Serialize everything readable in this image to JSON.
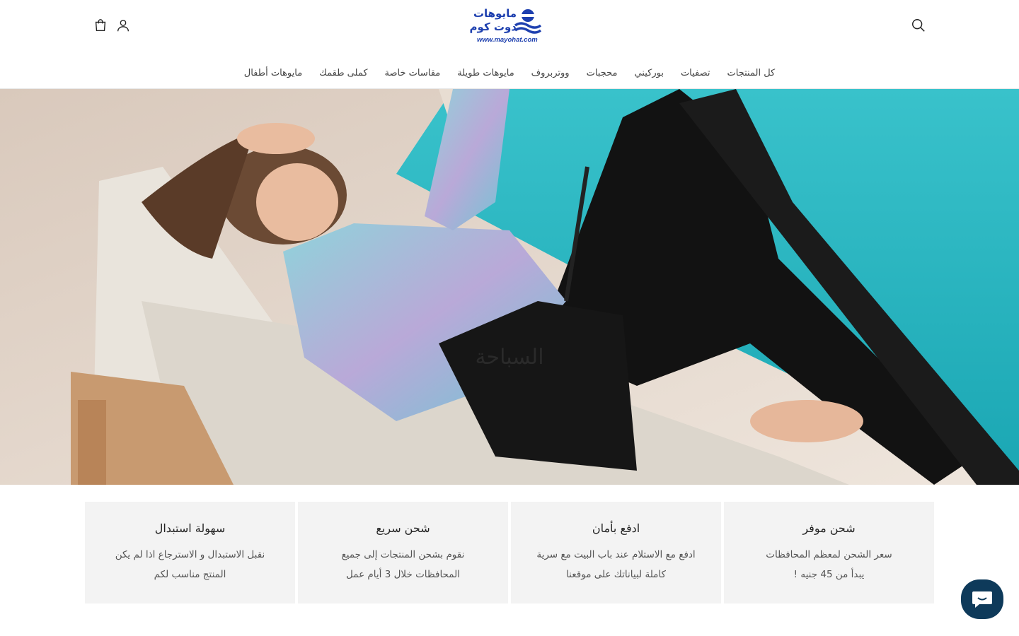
{
  "header": {
    "logo": {
      "arabic_line1": "مايوهات",
      "arabic_line2": "دوت كوم",
      "url": "www.mayohat.com"
    },
    "icons": {
      "cart": "cart-icon",
      "account": "account-icon",
      "search": "search-icon"
    },
    "nav": [
      {
        "label": "كل المنتجات"
      },
      {
        "label": "تصفيات"
      },
      {
        "label": "بوركيني"
      },
      {
        "label": "محجبات"
      },
      {
        "label": "ووتربروف"
      },
      {
        "label": "مايوهات طويلة"
      },
      {
        "label": "مقاسات خاصة"
      },
      {
        "label": "كملى طقمك"
      },
      {
        "label": "مايوهات أطفال"
      }
    ]
  },
  "hero": {
    "title": "السباحة"
  },
  "features": [
    {
      "title": "شحن موفر",
      "line1": "سعر الشحن لمعظم المحافظات",
      "line2": "يبدأ من 45 جنيه !"
    },
    {
      "title": "ادفع بأمان",
      "line1": "ادفع مع الاستلام عند باب البيت مع سرية",
      "line2": "كاملة لبياناتك على موقعنا"
    },
    {
      "title": "شحن سريع",
      "line1": "نقوم بشحن المنتجات إلى جميع",
      "line2": "المحافظات خلال 3 أيام عمل"
    },
    {
      "title": "سهولة استبدال",
      "line1": "نقبل الاستبدال و الاسترجاع اذا لم يكن",
      "line2": "المنتج مناسب لكم"
    }
  ],
  "colors": {
    "brand": "#1e40af",
    "pool": "#2ab5bf",
    "chat": "#0e3a5a"
  }
}
